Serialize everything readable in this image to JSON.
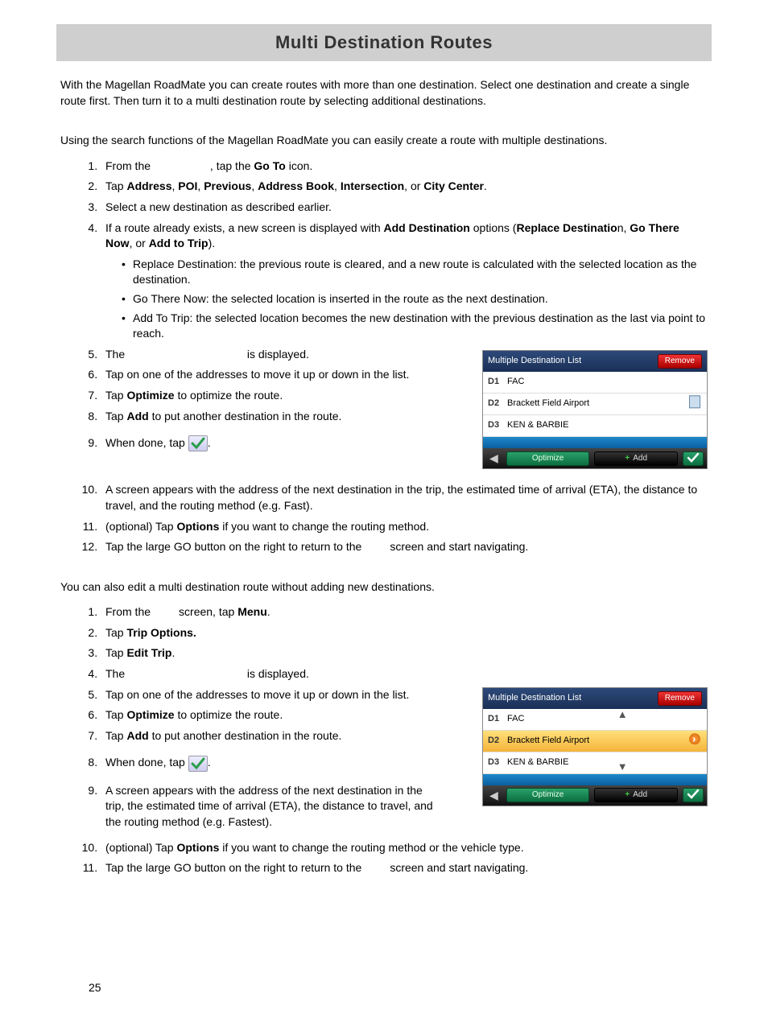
{
  "title": "Multi Destination Routes",
  "pageNumber": "25",
  "intro": "With the Magellan RoadMate you can create routes with more than one destination. Select one destination and create a single route first. Then turn it to a multi destination route by selecting additional destinations.",
  "sectionA": {
    "intro": "Using the search functions of the Magellan RoadMate you can easily create a route with multiple destinations.",
    "steps": {
      "s1a": "From the ",
      "s1b": ", tap the ",
      "s1c": "Go To",
      "s1d": " icon.",
      "s2a": "Tap ",
      "s2_addr": "Address",
      "s2_poi": "POI",
      "s2_prev": "Previous",
      "s2_book": "Address Book",
      "s2_int": "Intersection",
      "s2_cc": "City Center",
      "s3": "Select a new destination as described earlier.",
      "s4a": "If a route already exists, a new screen is displayed with ",
      "s4b": "Add Destination",
      "s4c": " options (",
      "s4d": "Replace Destinatio",
      "s4e": "n, ",
      "s4f": "Go There Now",
      "s4g": ", or ",
      "s4h": "Add to Trip",
      "s4i": ").",
      "b1": "Replace Destination: the previous route is cleared, and a new route is calculated with the selected location as the destination.",
      "b2": "Go There Now: the selected location is inserted in the route as the next destination.",
      "b3": "Add To Trip: the selected location becomes the new destination with the previous destination as the last via point to reach.",
      "s5a": "The ",
      "s5b": " is displayed.",
      "s6": "Tap on one of the addresses to move it up or down in the list.",
      "s7a": "Tap ",
      "s7b": "Optimize",
      "s7c": " to optimize the route.",
      "s8a": "Tap ",
      "s8b": "Add",
      "s8c": " to put another destination in the route.",
      "s9a": "When done, tap ",
      "s9b": ".",
      "s10": "A screen appears with the address of the next destination in the trip, the estimated time of arrival (ETA), the distance to travel, and the routing method (e.g. Fast).",
      "s11a": "(optional) Tap ",
      "s11b": "Options",
      "s11c": " if you want to change the routing method.",
      "s12a": "Tap the large GO button on the right to return to the ",
      "s12b": " screen and start navigating."
    }
  },
  "sectionB": {
    "intro": "You can also edit a multi destination route without adding new destinations.",
    "steps": {
      "s1a": "From the ",
      "s1b": " screen, tap ",
      "s1c": "Menu",
      "s1d": ".",
      "s2a": "Tap ",
      "s2b": "Trip Options.",
      "s3a": "Tap ",
      "s3b": "Edit Trip",
      "s3c": ".",
      "s4a": "The ",
      "s4b": " is displayed.",
      "s5": "Tap on one of the addresses to move it up or down in the list.",
      "s6a": "Tap ",
      "s6b": "Optimize",
      "s6c": " to optimize the route.",
      "s7a": "Tap ",
      "s7b": "Add",
      "s7c": " to put another destination in the route.",
      "s8a": "When done, tap ",
      "s8b": ".",
      "s9": " A screen appears with the address of the next destination in the trip, the estimated time of arrival (ETA), the distance to travel, and the routing method (e.g. Fastest).",
      "s10a": "(optional) Tap ",
      "s10b": "Options",
      "s10c": " if you want to change the routing method or the vehicle type.",
      "s11a": "Tap the large GO button on the right to return to the ",
      "s11b": " screen and start navigating."
    }
  },
  "figure": {
    "title": "Multiple Destination List",
    "remove": "Remove",
    "rows": [
      {
        "lbl": "D1",
        "val": "FAC"
      },
      {
        "lbl": "D2",
        "val": "Brackett Field Airport"
      },
      {
        "lbl": "D3",
        "val": "KEN & BARBIE"
      }
    ],
    "optimize": "Optimize",
    "add": "Add"
  }
}
